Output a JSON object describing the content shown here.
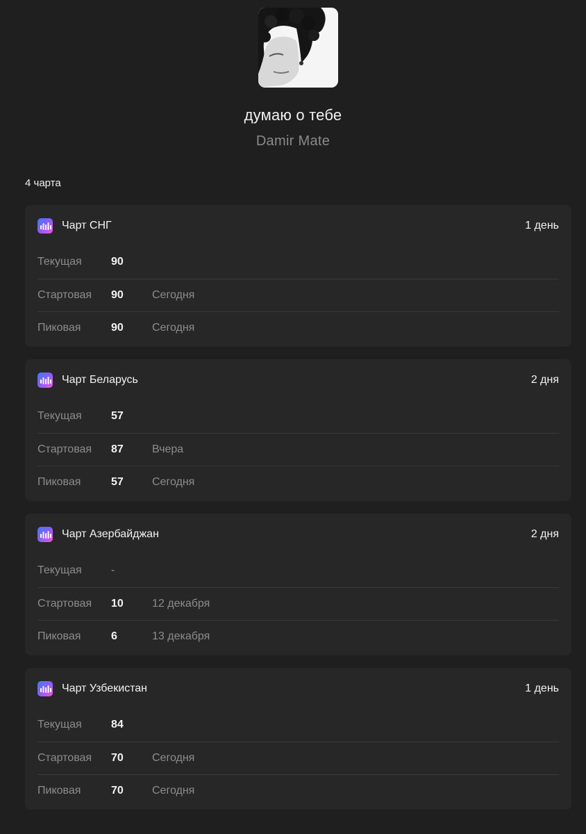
{
  "track": {
    "title": "думаю о тебе",
    "artist": "Damir Mate"
  },
  "chart_count_label": "4 чарта",
  "charts": [
    {
      "name": "Чарт СНГ",
      "days": "1 день",
      "rows": [
        {
          "label": "Текущая",
          "value": "90",
          "date": ""
        },
        {
          "label": "Стартовая",
          "value": "90",
          "date": "Сегодня"
        },
        {
          "label": "Пиковая",
          "value": "90",
          "date": "Сегодня"
        }
      ]
    },
    {
      "name": "Чарт Беларусь",
      "days": "2 дня",
      "rows": [
        {
          "label": "Текущая",
          "value": "57",
          "date": ""
        },
        {
          "label": "Стартовая",
          "value": "87",
          "date": "Вчера"
        },
        {
          "label": "Пиковая",
          "value": "57",
          "date": "Сегодня"
        }
      ]
    },
    {
      "name": "Чарт Азербайджан",
      "days": "2 дня",
      "rows": [
        {
          "label": "Текущая",
          "value": "-",
          "date": ""
        },
        {
          "label": "Стартовая",
          "value": "10",
          "date": "12 декабря"
        },
        {
          "label": "Пиковая",
          "value": "6",
          "date": "13 декабря"
        }
      ]
    },
    {
      "name": "Чарт Узбекистан",
      "days": "1 день",
      "rows": [
        {
          "label": "Текущая",
          "value": "84",
          "date": ""
        },
        {
          "label": "Стартовая",
          "value": "70",
          "date": "Сегодня"
        },
        {
          "label": "Пиковая",
          "value": "70",
          "date": "Сегодня"
        }
      ]
    }
  ],
  "icons": {
    "chart_icon": "soundwave-chart-icon"
  },
  "colors": {
    "background": "#1f1f1f",
    "card": "#272727",
    "muted_text": "#8c8c8c",
    "icon_gradient": [
      "#3d7bff",
      "#8a5cff",
      "#ff4fd8"
    ]
  }
}
